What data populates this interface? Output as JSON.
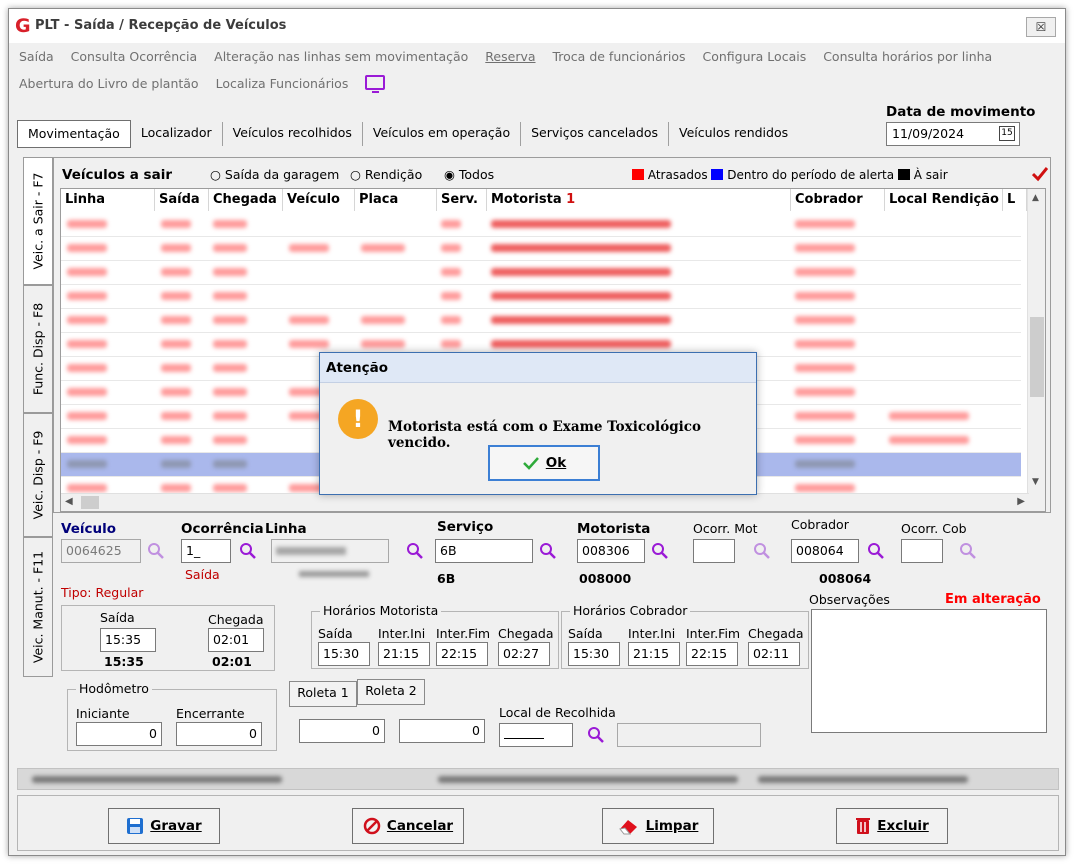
{
  "window": {
    "title": "PLT - Saída / Recepção de Veículos",
    "close_label": "☒"
  },
  "menu": {
    "row1": [
      "Saída",
      "Consulta Ocorrência",
      "Alteração nas linhas sem movimentação",
      "Reserva",
      "Troca de funcionários",
      "Configura Locais",
      "Consulta horários por linha"
    ],
    "row2": [
      "Abertura do Livro de plantão",
      "Localiza Funcionários"
    ]
  },
  "tabs": [
    "Movimentação",
    "Localizador",
    "Veículos recolhidos",
    "Veículos em operação",
    "Serviços cancelados",
    "Veículos rendidos"
  ],
  "date": {
    "label": "Data de movimento",
    "value": "11/09/2024",
    "calendar_label": "15"
  },
  "side_tabs": [
    "Veic. a Sair - F7",
    "Func. Disp - F8",
    "Veic. Disp - F9",
    "Veic. Manut. - F11"
  ],
  "grid": {
    "heading": "Veículos a sair",
    "filters": [
      "Saída da garagem",
      "Rendição",
      "Todos"
    ],
    "legend": [
      "Atrasados",
      "Dentro do período de alerta",
      "À sair"
    ],
    "columns": [
      "Linha",
      "Saída",
      "Chegada",
      "Veículo",
      "Placa",
      "Serv.",
      "Motorista",
      "Cobrador",
      "Local Rendição",
      "L"
    ],
    "sort_marker": "1"
  },
  "form": {
    "veiculo_label": "Veículo",
    "veiculo_value": "0064625",
    "ocorrencia_label": "Ocorrência",
    "ocorrencia_value": "1_",
    "ocorrencia_sub": "Saída",
    "linha_label": "Linha",
    "servico_label": "Serviço",
    "servico_value": "6B",
    "servico_sub": "6B",
    "motorista_label": "Motorista",
    "motorista_value": "008306",
    "motorista_sub": "008000",
    "ocorr_mot_label": "Ocorr. Mot",
    "cobrador_label": "Cobrador",
    "cobrador_value": "008064",
    "cobrador_sub": "008064",
    "ocorr_cob_label": "Ocorr. Cob",
    "tipo": "Tipo: Regular",
    "observacoes_label": "Observações",
    "status": "Em alteração",
    "saida_label": "Saída",
    "saida_value": "15:35",
    "saida_sub": "15:35",
    "chegada_label": "Chegada",
    "chegada_value": "02:01",
    "chegada_sub": "02:01",
    "hor_mot_title": "Horários Motorista",
    "hor_cob_title": "Horários Cobrador",
    "hor_cols": [
      "Saída",
      "Inter.Ini",
      "Inter.Fim",
      "Chegada"
    ],
    "hor_mot_values": [
      "15:30",
      "21:15",
      "22:15",
      "02:27"
    ],
    "hor_cob_values": [
      "15:30",
      "21:15",
      "22:15",
      "02:11"
    ],
    "hodometro_title": "Hodômetro",
    "iniciante_label": "Iniciante",
    "iniciante_value": "0",
    "encerrante_label": "Encerrante",
    "encerrante_value": "0",
    "roleta1_label": "Roleta 1",
    "roleta2_label": "Roleta 2",
    "roleta1_value": "0",
    "roleta2_value": "0",
    "local_recolhida_label": "Local de Recolhida"
  },
  "buttons": {
    "gravar": "Gravar",
    "cancelar": "Cancelar",
    "limpar": "Limpar",
    "excluir": "Excluir"
  },
  "dialog": {
    "title": "Atenção",
    "message": "Motorista está com o Exame Toxicológico vencido.",
    "ok": "Ok",
    "icon": "!"
  },
  "colors": {
    "atrasados": "#ff0000",
    "alerta": "#0000ff",
    "a_sair": "#000000",
    "accent_purple": "#9a1ad6",
    "status_red": "#ff0000",
    "label_blue": "#00007a"
  }
}
